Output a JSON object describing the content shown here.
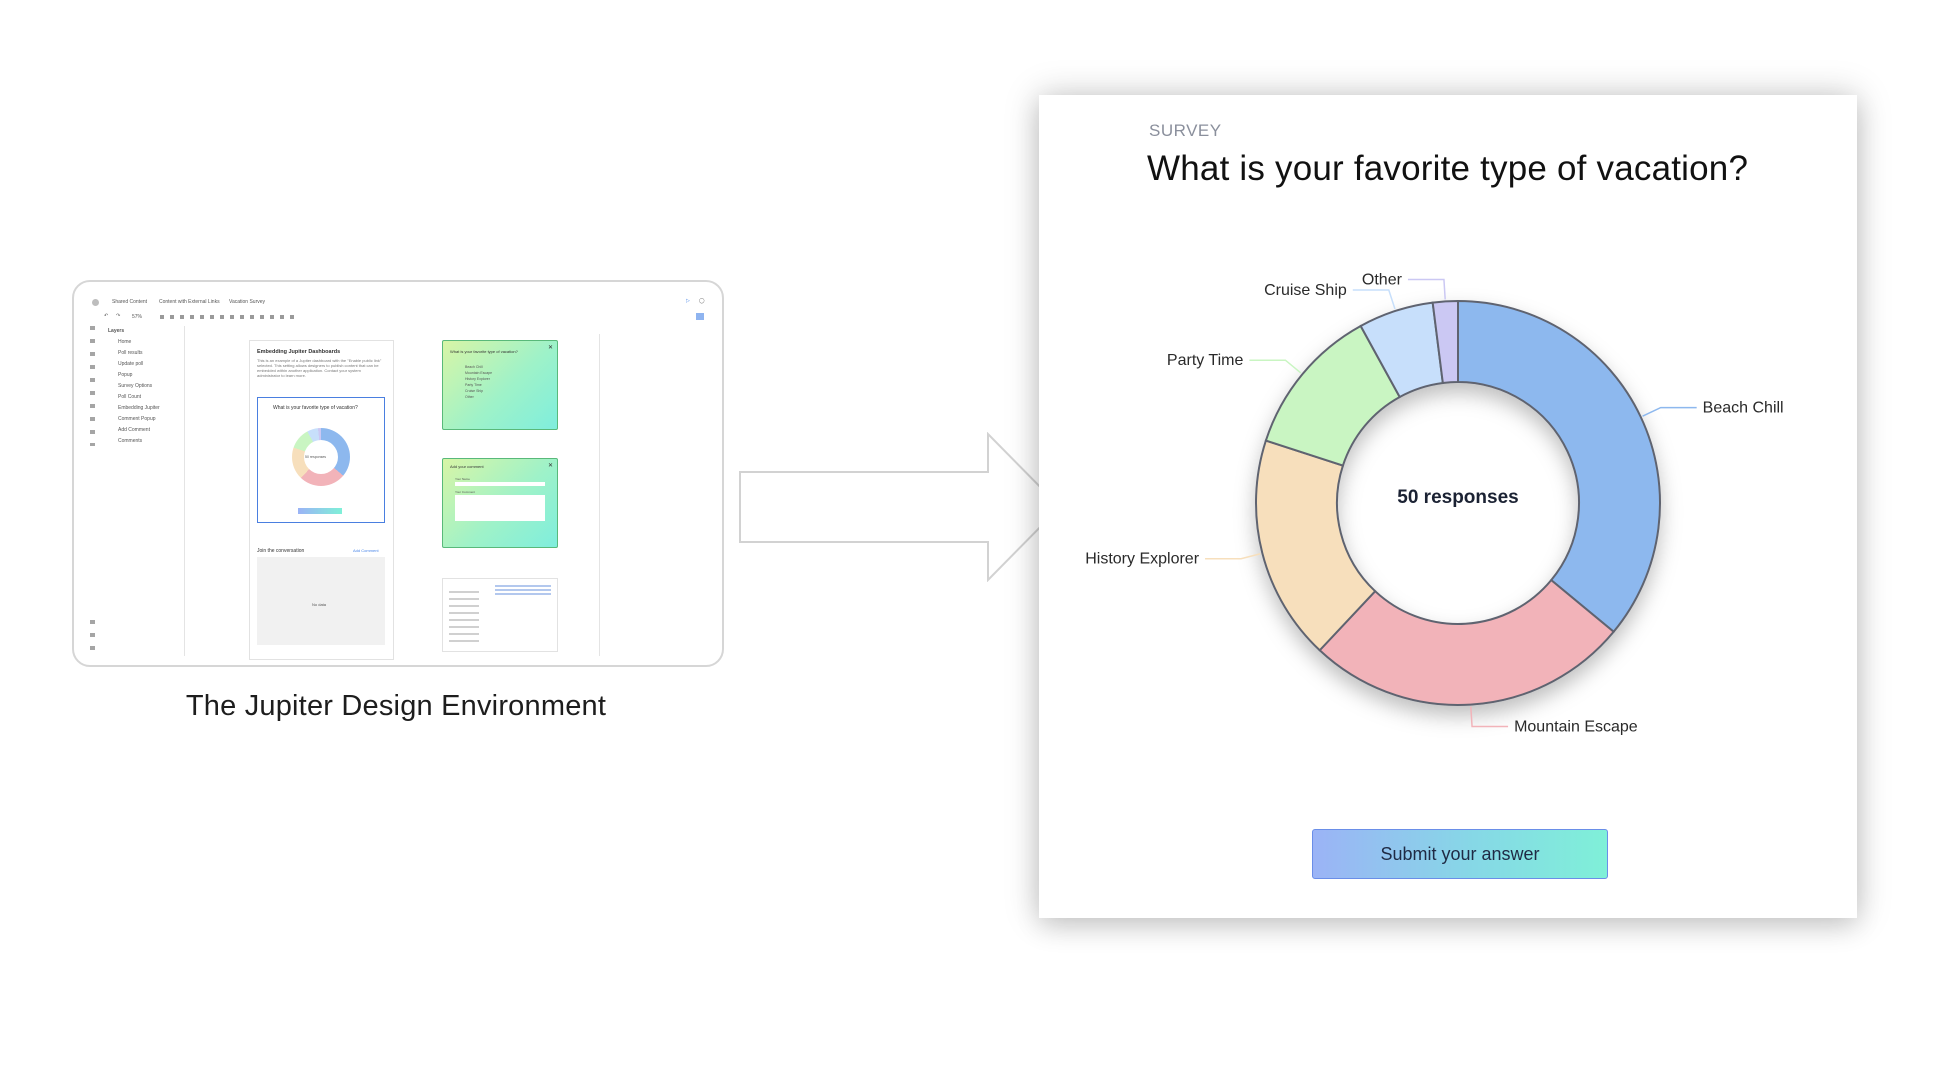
{
  "thumbnail": {
    "caption": "The Jupiter Design Environment",
    "breadcrumb": [
      "Shared Content",
      "Content with External Links",
      "Vacation Survey"
    ],
    "zoom": "57%",
    "layers_title": "Layers",
    "layers": [
      "Home",
      "Poll results",
      "Update poll",
      "Popup",
      "Survey Options",
      "Poll Count",
      "Embedding Jupiter",
      "Comment Popup",
      "Add Comment",
      "Comments"
    ],
    "doc_title": "Embedding Jupiter Dashboards",
    "doc_text": "This is an example of a Jupiter dashboard with the \"Enable public link\" selected. This setting allows designers to publish content that can be embedded within another application. Contact your system administrator to learn more.",
    "mini_question": "What is your favorite type of vacation?",
    "mini_center": "50 responses",
    "conversation_title": "Join the conversation",
    "add_comment": "Add Comment",
    "no_data": "No data",
    "popup_question": "What is your favorite type of vacation?",
    "popup_options": [
      "Beach Chill",
      "Mountain Escape",
      "History Explorer",
      "Party Time",
      "Cruise Ship",
      "Other"
    ],
    "comment_title": "Add your comment",
    "comment_name": "Your Name",
    "comment_label": "Your Comment"
  },
  "survey": {
    "eyebrow": "SURVEY",
    "question": "What is your favorite type of vacation?",
    "center_label": "50 responses",
    "submit_label": "Submit your answer"
  },
  "colors": {
    "beach": "#8db8ee",
    "mountain": "#f2b3b9",
    "history": "#f7dfbc",
    "party": "#c9f5c2",
    "cruise": "#c7dffb",
    "other": "#cbc8f3"
  },
  "chart_data": {
    "type": "pie",
    "donut": true,
    "categories": [
      "Beach Chill",
      "Mountain Escape",
      "History Explorer",
      "Party Time",
      "Cruise Ship",
      "Other"
    ],
    "values": [
      18,
      13,
      9,
      6,
      3,
      1
    ],
    "center_text": "50 responses"
  }
}
